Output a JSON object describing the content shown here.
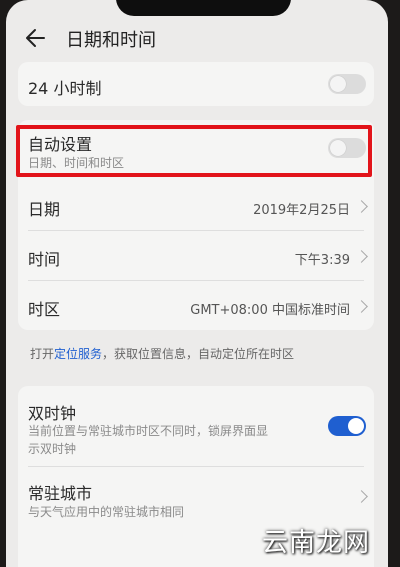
{
  "header": {
    "title": "日期和时间"
  },
  "rows": {
    "hour24": {
      "label": "24 小时制",
      "toggle": "off"
    },
    "auto": {
      "label": "自动设置",
      "sub": "日期、时间和时区",
      "toggle": "off"
    },
    "date": {
      "label": "日期",
      "value": "2019年2月25日"
    },
    "time": {
      "label": "时间",
      "value": "下午3:39"
    },
    "timezone": {
      "label": "时区",
      "value": "GMT+08:00 中国标准时间"
    }
  },
  "hint": {
    "prefix": "打开",
    "link": "定位服务",
    "suffix": "，获取位置信息，自动定位所在时区"
  },
  "dual": {
    "label": "双时钟",
    "sub_line1": "当前位置与常驻城市时区不同时，锁屏界面显",
    "sub_line2": "示双时钟",
    "toggle": "on"
  },
  "home_city": {
    "label": "常驻城市",
    "sub": "与天气应用中的常驻城市相同"
  },
  "colors": {
    "accent": "#1f5fd0",
    "highlight": "#e2141a"
  },
  "watermark": "云南龙网"
}
